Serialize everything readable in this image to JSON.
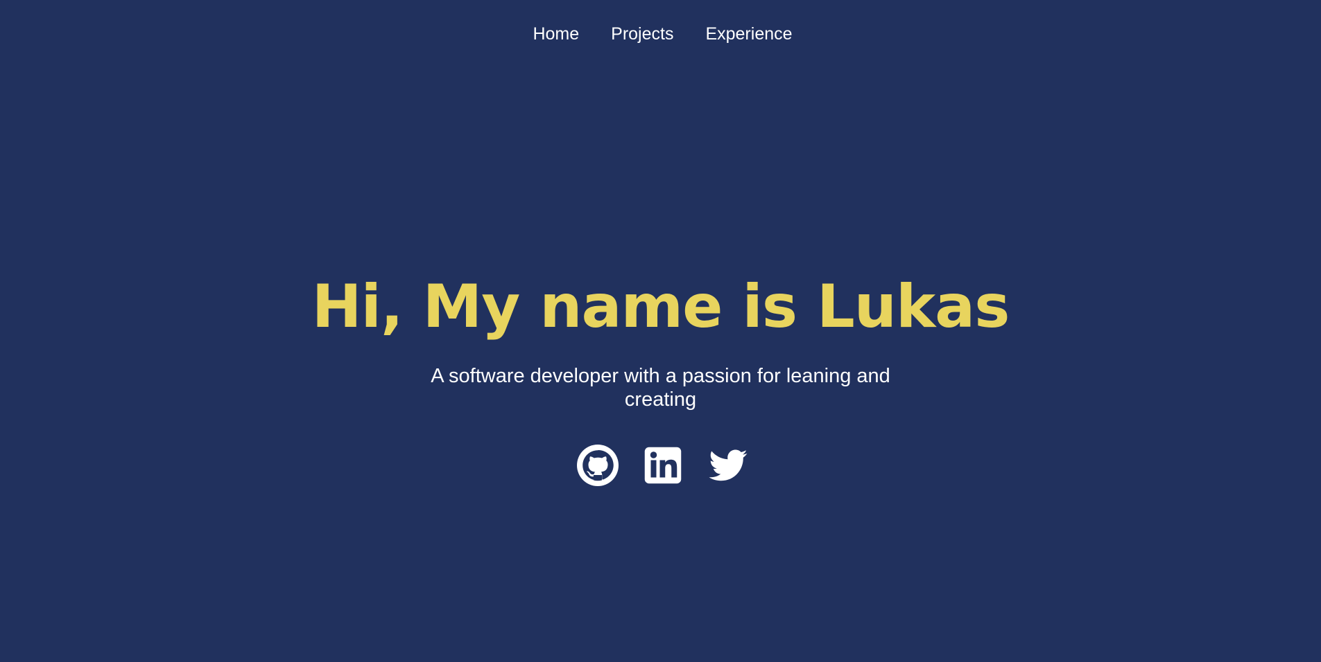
{
  "nav": {
    "items": [
      {
        "label": "Home"
      },
      {
        "label": "Projects"
      },
      {
        "label": "Experience"
      }
    ]
  },
  "hero": {
    "title": "Hi, My name is Lukas",
    "subtitle": "A software developer with a passion for leaning and creating"
  },
  "socials": [
    {
      "icon": "github-icon"
    },
    {
      "icon": "linkedin-icon"
    },
    {
      "icon": "twitter-icon"
    }
  ],
  "colors": {
    "background": "#21315e",
    "accent": "#e8d45e",
    "text": "#ffffff"
  }
}
